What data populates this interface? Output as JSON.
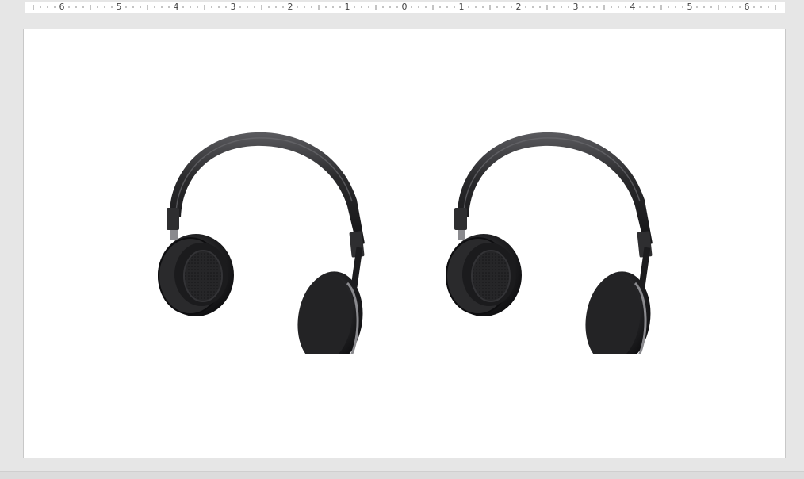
{
  "ruler": {
    "labels": [
      "6",
      "5",
      "4",
      "3",
      "2",
      "1",
      "0",
      "1",
      "2",
      "3",
      "4",
      "5",
      "6"
    ],
    "unit": "inches"
  },
  "slide": {
    "objects": [
      {
        "type": "3d-model",
        "name": "headphones"
      },
      {
        "type": "3d-model",
        "name": "headphones"
      }
    ]
  },
  "colors": {
    "workspace": "#e6e6e6",
    "slide": "#ffffff",
    "headphone_body": "#2b2b2d"
  }
}
